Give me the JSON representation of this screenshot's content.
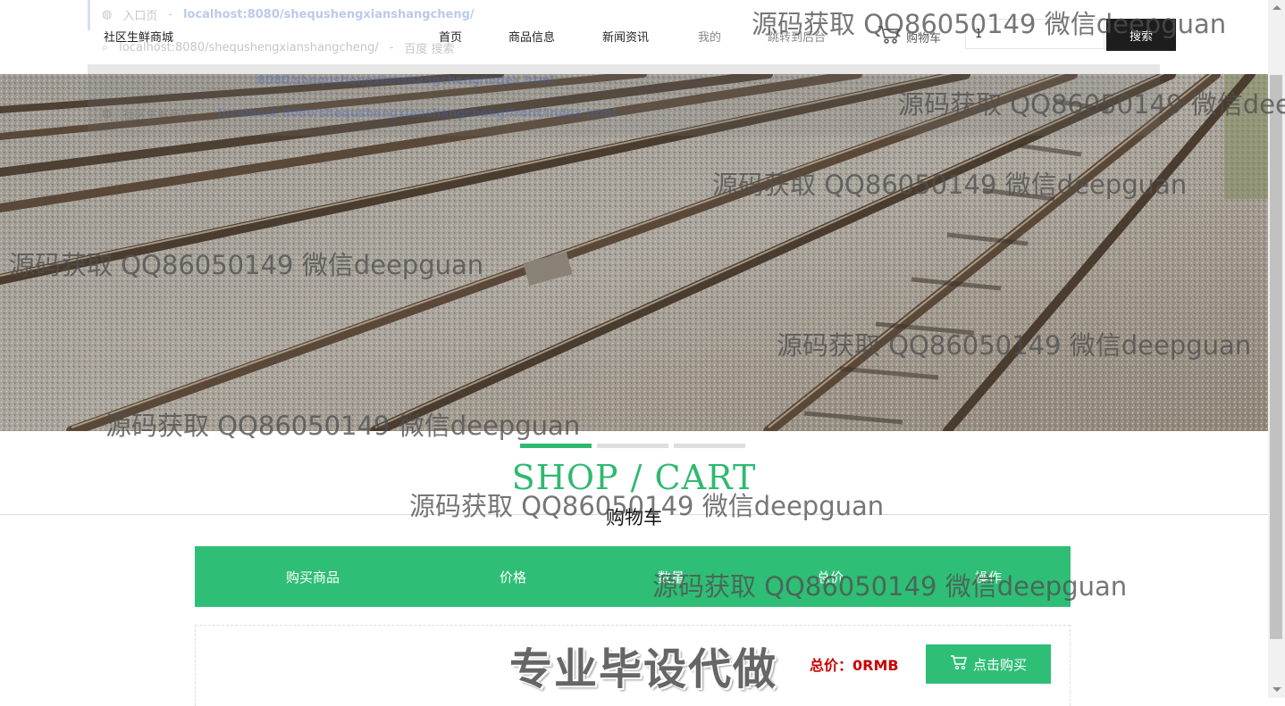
{
  "header": {
    "brand": "社区生鲜商城",
    "nav": [
      "首页",
      "商品信息",
      "新闻资讯",
      "我的",
      "跳转到后台"
    ],
    "cart_label": "购物车",
    "search_value": "1",
    "search_button": "搜索"
  },
  "autocomplete": {
    "rows": [
      {
        "title": "入口页",
        "url": "localhost:8080/shequshengxianshangcheng/"
      },
      {
        "title": "localhost:8080/shequshengxianshangcheng/",
        "url": "百度 搜索"
      },
      {
        "title": "",
        "url": "8080/shequshengxianshangcheng/index.html"
      },
      {
        "title": "社区生鲜商城",
        "url": "localhost:8080/shequshengxianshangcheng/front/index.html"
      }
    ]
  },
  "section": {
    "en_title": "SHOP / CART",
    "cn_title": "购物车"
  },
  "cart": {
    "columns": [
      "购买商品",
      "价格",
      "数量",
      "总价",
      "操作"
    ],
    "total_label": "总价：",
    "total_value": "0RMB",
    "buy_button": "点击购买"
  },
  "overlays": {
    "watermark": "源码获取 QQ86050149 微信deepguan",
    "stamp": "专业毕设代做"
  },
  "colors": {
    "accent": "#2fbe76",
    "price": "#cc0000",
    "dark_button": "#1d1d1d"
  }
}
